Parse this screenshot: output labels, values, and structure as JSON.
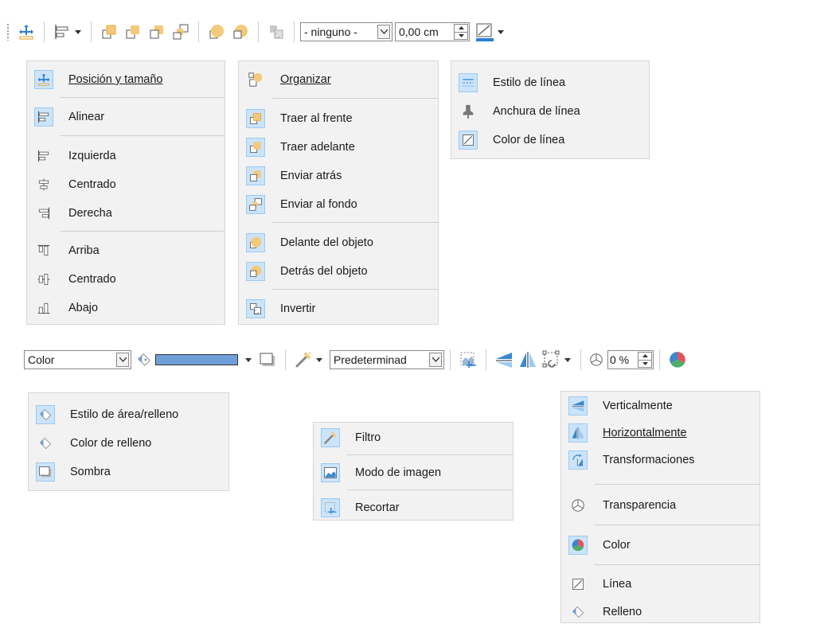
{
  "toolbar1": {
    "line_arrow_style": "- ninguno -",
    "line_width": "0,00 cm"
  },
  "menu_position": {
    "items": [
      {
        "label": "Posición y tamaño",
        "icon": "position-size-icon"
      },
      {
        "label": "Alinear",
        "icon": "align-icon"
      },
      {
        "label": "Izquierda",
        "icon": "align-left-icon"
      },
      {
        "label": "Centrado",
        "icon": "align-center-icon"
      },
      {
        "label": "Derecha",
        "icon": "align-right-icon"
      },
      {
        "label": "Arriba",
        "icon": "align-top-icon"
      },
      {
        "label": "Centrado",
        "icon": "align-middle-icon"
      },
      {
        "label": "Abajo",
        "icon": "align-bottom-icon"
      }
    ]
  },
  "menu_arrange": {
    "items": [
      {
        "label": "Organizar",
        "icon": "arrange-icon"
      },
      {
        "label": "Traer al frente",
        "icon": "bring-to-front-icon"
      },
      {
        "label": "Traer adelante",
        "icon": "bring-forward-icon"
      },
      {
        "label": "Enviar atrás",
        "icon": "send-backward-icon"
      },
      {
        "label": "Enviar al fondo",
        "icon": "send-to-back-icon"
      },
      {
        "label": "Delante del objeto",
        "icon": "in-front-of-object-icon"
      },
      {
        "label": "Detrás del objeto",
        "icon": "behind-object-icon"
      },
      {
        "label": "Invertir",
        "icon": "reverse-icon"
      }
    ]
  },
  "menu_line": {
    "items": [
      {
        "label": "Estilo de línea",
        "icon": "line-style-icon"
      },
      {
        "label": "Anchura de línea",
        "icon": "line-width-icon"
      },
      {
        "label": "Color de línea",
        "icon": "line-color-icon"
      }
    ]
  },
  "toolbar2": {
    "area_style": "Color",
    "fill_color": "#6f9fd8",
    "graphics_mode": "Predeterminad",
    "transparency": "0 %"
  },
  "menu_area": {
    "items": [
      {
        "label": "Estilo de área/relleno",
        "icon": "area-style-icon"
      },
      {
        "label": "Color de relleno",
        "icon": "fill-color-icon"
      },
      {
        "label": "Sombra",
        "icon": "shadow-icon"
      }
    ]
  },
  "menu_filter": {
    "items": [
      {
        "label": "Filtro",
        "icon": "filter-icon"
      },
      {
        "label": "Modo de imagen",
        "icon": "image-mode-icon"
      },
      {
        "label": "Recortar",
        "icon": "crop-icon"
      }
    ]
  },
  "menu_flip": {
    "items": [
      {
        "label": "Verticalmente",
        "icon": "flip-vertical-icon"
      },
      {
        "label": "Horizontalmente",
        "icon": "flip-horizontal-icon"
      },
      {
        "label": "Transformaciones",
        "icon": "transformations-icon"
      },
      {
        "label": "Transparencia",
        "icon": "transparency-icon"
      },
      {
        "label": "Color",
        "icon": "color-icon"
      },
      {
        "label": "Línea",
        "icon": "line-icon"
      },
      {
        "label": "Relleno",
        "icon": "fill-icon"
      }
    ]
  },
  "colors": {
    "orange": "#f5c97a",
    "orange_dark": "#e8a93a",
    "blue": "#2a7fd4",
    "highlight": "#cbe4fa"
  }
}
